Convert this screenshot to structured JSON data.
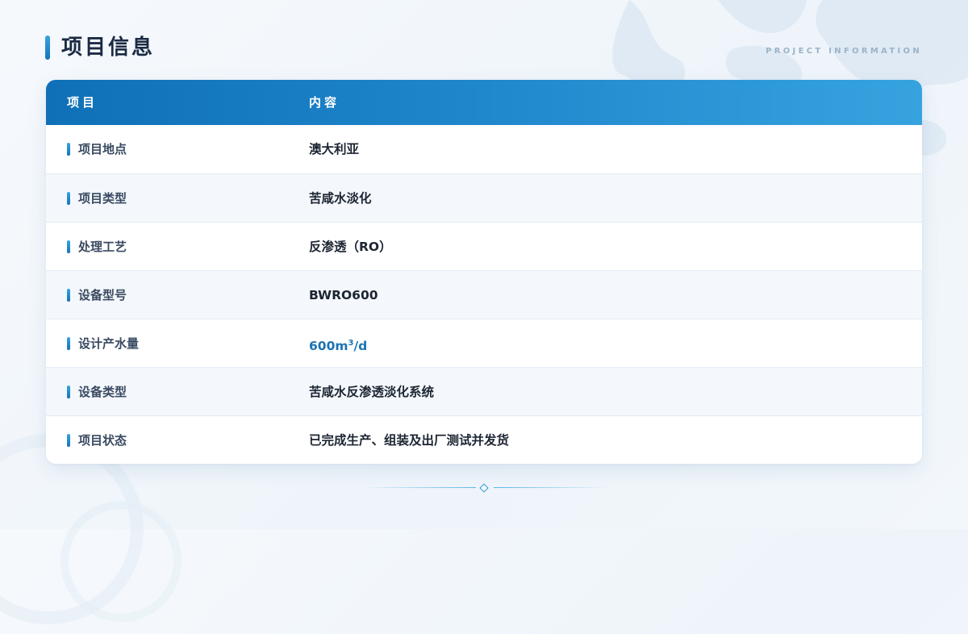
{
  "header": {
    "title": "项目信息",
    "subtitle": "PROJECT INFORMATION"
  },
  "table": {
    "columns": [
      "项目",
      "内容"
    ],
    "rows": [
      {
        "label": "项目地点",
        "value": "澳大利亚"
      },
      {
        "label": "项目类型",
        "value": "苦咸水淡化"
      },
      {
        "label": "处理工艺",
        "value": "反渗透（RO）"
      },
      {
        "label": "设备型号",
        "value": "BWRO600"
      },
      {
        "label": "设计产水量",
        "value_main": "600m",
        "value_sup": "3",
        "value_tail": "/d"
      },
      {
        "label": "设备类型",
        "value": "苦咸水反渗透淡化系统"
      },
      {
        "label": "项目状态",
        "value": "已完成生产、组装及出厂测试并发货"
      }
    ]
  },
  "colors": {
    "accent": "#1f87cc",
    "header_gradient_start": "#0f70b7",
    "header_gradient_end": "#36a3df",
    "highlight_value": "#1c73b4",
    "title_text": "#1b2a44"
  },
  "icons": {
    "title_marker": "vertical-bar",
    "row_marker": "vertical-bar",
    "divider_ornament": "diamond"
  }
}
